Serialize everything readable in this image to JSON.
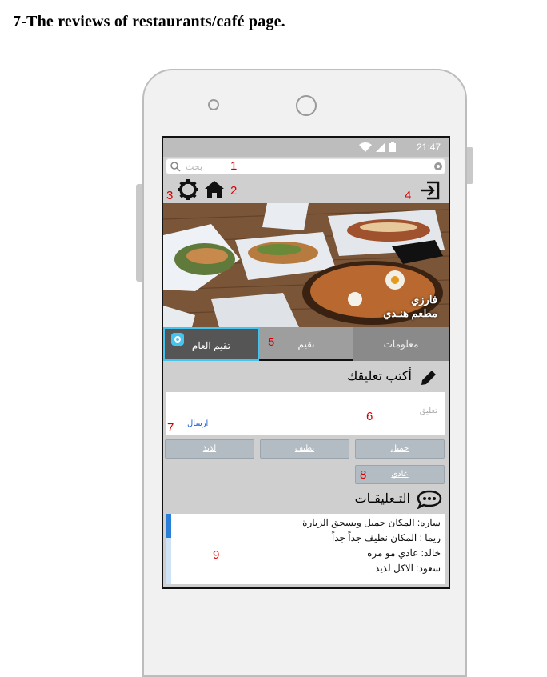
{
  "page_heading": "7-The reviews of restaurants/café page.",
  "status_bar": {
    "time": "21:47"
  },
  "search": {
    "placeholder": "بحث"
  },
  "restaurant": {
    "name_line1": "فارزي",
    "name_line2": "مطعم هنـدي"
  },
  "tabs": [
    {
      "label": "تقيم العام",
      "selected": true
    },
    {
      "label": "تقيم",
      "selected": false
    },
    {
      "label": "معلومات",
      "selected": false
    }
  ],
  "write_comment": {
    "title": "أكتب تعليقك",
    "placeholder": "تعليق",
    "send_label": "ارسال"
  },
  "rating_options": [
    "جميل",
    "نظيف",
    "لذيذ",
    "عادي"
  ],
  "comments_section": {
    "title": "التـعليقـات",
    "items": [
      "ساره: المكان جميل ويسحق الزيارة",
      "ريما : المكان نظيف جداً جداً",
      "خالد: عادي مو مره",
      "سعود: الاكل لذيذ"
    ]
  },
  "annotations": [
    "1",
    "2",
    "3",
    "4",
    "5",
    "6",
    "7",
    "8",
    "9"
  ],
  "colors": {
    "annotation": "#d40000",
    "accent": "#45c4f0",
    "link": "#1a5fd0"
  }
}
